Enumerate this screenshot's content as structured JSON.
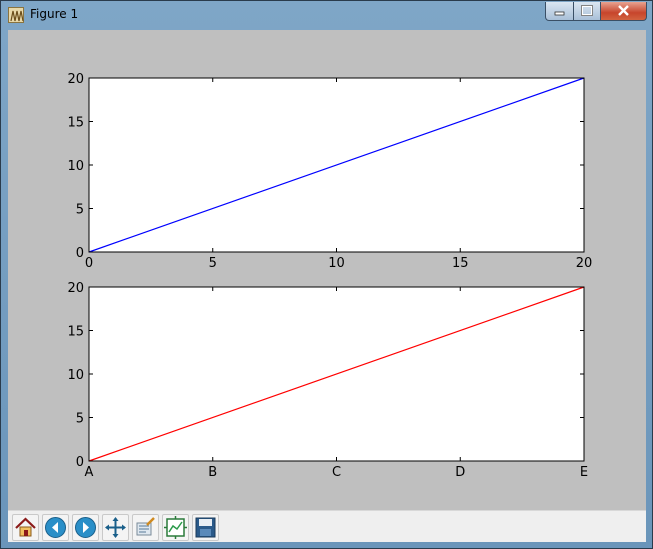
{
  "window": {
    "title": "Figure 1",
    "controls": [
      "minimize",
      "maximize",
      "close"
    ]
  },
  "toolbar": {
    "tools": [
      {
        "name": "home-icon",
        "hint": "home"
      },
      {
        "name": "back-icon",
        "hint": "back"
      },
      {
        "name": "forward-icon",
        "hint": "forward"
      },
      {
        "name": "pan-icon",
        "hint": "pan"
      },
      {
        "name": "zoom-icon",
        "hint": "zoom"
      },
      {
        "name": "subplots-icon",
        "hint": "configure subplots"
      },
      {
        "name": "save-icon",
        "hint": "save"
      }
    ]
  },
  "colors": {
    "figure_bg": "#bfbfbf",
    "axes_bg": "#ffffff",
    "top_series": "#0000ff",
    "bottom_series": "#ff0000"
  },
  "chart_data": [
    {
      "type": "line",
      "series": [
        {
          "x": [
            0,
            20
          ],
          "y": [
            0,
            20
          ],
          "color": "#0000ff"
        }
      ],
      "xlim": [
        0,
        20
      ],
      "ylim": [
        0,
        20
      ],
      "xticks": [
        0,
        5,
        10,
        15,
        20
      ],
      "xtick_labels": [
        "0",
        "5",
        "10",
        "15",
        "20"
      ],
      "yticks": [
        0,
        5,
        10,
        15,
        20
      ],
      "ytick_labels": [
        "0",
        "5",
        "10",
        "15",
        "20"
      ],
      "grid": false
    },
    {
      "type": "line",
      "series": [
        {
          "x": [
            0,
            20
          ],
          "y": [
            0,
            20
          ],
          "color": "#ff0000"
        }
      ],
      "xlim": [
        0,
        20
      ],
      "ylim": [
        0,
        20
      ],
      "xticks": [
        0,
        5,
        10,
        15,
        20
      ],
      "xtick_labels": [
        "A",
        "B",
        "C",
        "D",
        "E"
      ],
      "yticks": [
        0,
        5,
        10,
        15,
        20
      ],
      "ytick_labels": [
        "0",
        "5",
        "10",
        "15",
        "20"
      ],
      "grid": false
    }
  ]
}
